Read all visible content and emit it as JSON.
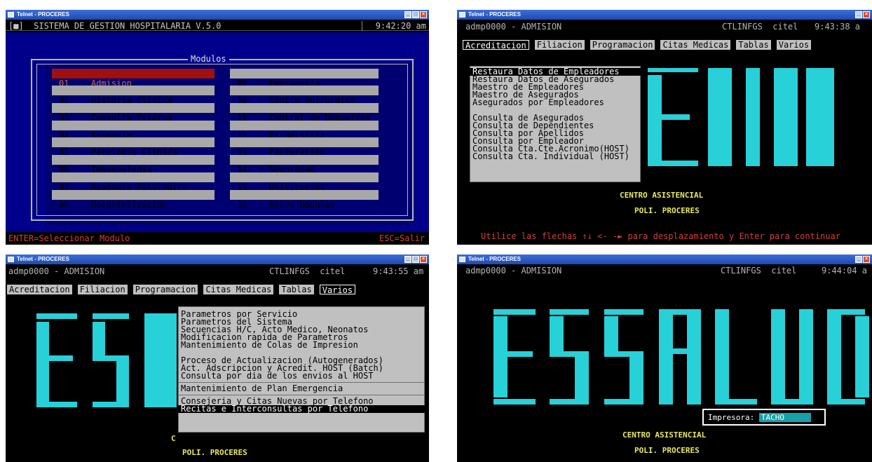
{
  "colors": {
    "console_bg": "#000000",
    "text": "#b4b4b4",
    "menu_bg": "#c0c0c0",
    "module_panel": "#00008a",
    "selected_module": "#a01010",
    "logo": "#28d0d8",
    "highlight": "#e8e860"
  },
  "windows": {
    "w1": {
      "title": "Telnet - PROCERES",
      "header_left": "[■]  SISTEMA DE GESTION HOSPITALARIA V.5.0",
      "time": "9:42:20 am",
      "modules_title": "Modulos",
      "modules_left": [
        {
          "num": "01",
          "label": "Admision"
        },
        {
          "num": "02",
          "label": "Historia Clinica"
        },
        {
          "num": "03",
          "label": "Consulta Externa"
        },
        {
          "num": "04",
          "label": "Farmacia"
        },
        {
          "num": "05",
          "label": "Patologia Clinica"
        },
        {
          "num": "06",
          "label": "Imagenologia"
        },
        {
          "num": "07",
          "label": "Anatomia Patologica"
        },
        {
          "num": "08",
          "label": "Hospitalizacion"
        }
      ],
      "modules_right": [
        {
          "num": "09",
          "label": "Emergencia"
        },
        {
          "num": "10",
          "label": "Centro Quirurgico"
        },
        {
          "num": "11",
          "label": "Central de Depositos"
        },
        {
          "num": "12",
          "label": "Estadistica"
        },
        {
          "num": "13",
          "label": "Facturacion"
        },
        {
          "num": "14",
          "label": "Seguridad"
        },
        {
          "num": "15",
          "label": "Utilitarios"
        },
        {
          "num": "16",
          "label": "Otros Modulos"
        }
      ],
      "footer_left": "ENTER=Seleccionar Modulo",
      "footer_right": "ESC=Salir"
    },
    "w2": {
      "title": "Telnet - PROCERES",
      "user": "admp0000 - ADMISION",
      "host": "CTLINFGS  citel",
      "time": "9:43:38 a",
      "menu": [
        "Acreditacion",
        "Filiacion",
        "Programacion",
        "Citas Medicas",
        "Tablas",
        "Varios"
      ],
      "dropdown_group1": [
        "Restaura Datos de Empleadores",
        "Restaura Datos de Asegurados",
        "Maestro de Empleadores",
        "Maestro de Asegurados",
        "Asegurados por Empleadores"
      ],
      "dropdown_group2": [
        "Consulta de Asegurados",
        "Consulta de Dependientes",
        "Consulta por Apellidos",
        "Consulta por Empleador",
        "Consulta Cta.Cte.Acronimo(HOST)",
        "Consulta Cta. Individual (HOST)"
      ],
      "center_label": "CENTRO ASISTENCIAL",
      "branch": "POLI. PROCERES",
      "footer": "Utilice las flechas ↑↓ <- -► para desplazamiento y Enter para continuar"
    },
    "w3": {
      "title": "Telnet - PROCERES",
      "user": "admp0000 - ADMISION",
      "host": "CTLINFGS  citel",
      "time": "9:43:55 am",
      "menu": [
        "Acreditacion",
        "Filiacion",
        "Programacion",
        "Citas Medicas",
        "Tablas",
        "Varios"
      ],
      "dropdown_group1": [
        "Parametros por Servicio",
        "Parametros del Sistema",
        "Secuencias H/C, Acto Medico, Neonatos",
        "Modificacion rapida de Parametros",
        "Mantenimiento de Colas de Impresion"
      ],
      "dropdown_group2": [
        "Proceso de Actualizacion (Autogenerados)",
        "Act. Adscripcion y Acredit. HOST (Batch)",
        "Consulta por dia de los envios al HOST"
      ],
      "dropdown_group3": [
        "Mantenimiento de Plan Emergencia"
      ],
      "dropdown_group4": [
        "Consejeria y Citas Nuevas por Telefono",
        "Recitas e Interconsultas por Telefono"
      ],
      "center_letter": "C",
      "branch": "POLI. PROCERES"
    },
    "w4": {
      "title": "Telnet - PROCERES",
      "user": "admp0000 - ADMISION",
      "host": "CTLINFGS  citel",
      "time": "9:44:04 a",
      "printer_label": "Impresora:",
      "printer_value": "TACHO",
      "center_label": "CENTRO ASISTENCIAL",
      "branch": "POLI. PROCERES"
    }
  }
}
